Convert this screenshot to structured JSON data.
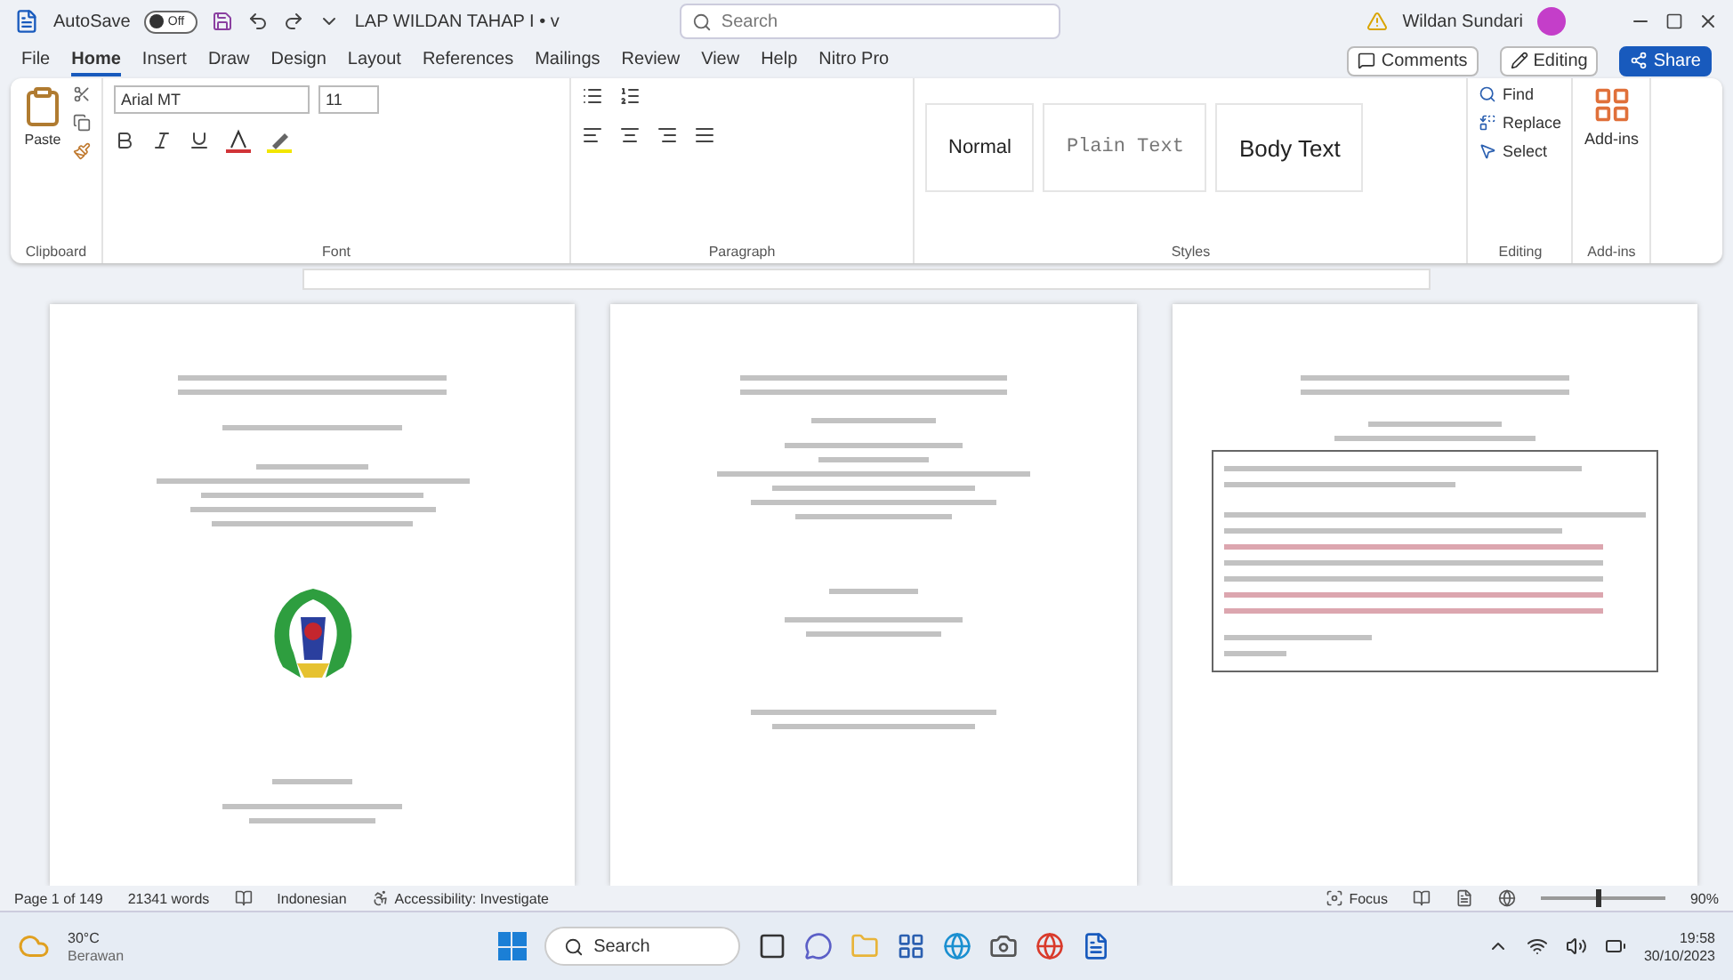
{
  "title_bar": {
    "autosave_label": "AutoSave",
    "autosave_state": "Off",
    "autosave_on": false,
    "document_title": "LAP WILDAN TAHAP I • v",
    "search_placeholder": "Search",
    "user_name": "Wildan Sundari"
  },
  "menu_tabs": [
    {
      "label": "File",
      "selected": false
    },
    {
      "label": "Home",
      "selected": true
    },
    {
      "label": "Insert",
      "selected": false
    },
    {
      "label": "Draw",
      "selected": false
    },
    {
      "label": "Design",
      "selected": false
    },
    {
      "label": "Layout",
      "selected": false
    },
    {
      "label": "References",
      "selected": false
    },
    {
      "label": "Mailings",
      "selected": false
    },
    {
      "label": "Review",
      "selected": false
    },
    {
      "label": "View",
      "selected": false
    },
    {
      "label": "Help",
      "selected": false
    },
    {
      "label": "Nitro Pro",
      "selected": false
    }
  ],
  "header_buttons": {
    "comments": "Comments",
    "editing": "Editing",
    "share": "Share"
  },
  "ribbon": {
    "paste": "Paste",
    "font_name": "Arial MT",
    "font_size": "11",
    "styles": [
      {
        "label": "Normal",
        "kind": "normal"
      },
      {
        "label": "Plain Text",
        "kind": "mono"
      },
      {
        "label": "Body Text",
        "kind": "body"
      }
    ],
    "editing": [
      "Find",
      "Replace",
      "Select"
    ],
    "addins": "Add-ins",
    "groups": [
      "Clipboard",
      "Font",
      "Paragraph",
      "Styles",
      "Editing",
      "Add-ins"
    ]
  },
  "pages": [
    {
      "kind": "cover"
    },
    {
      "kind": "approval"
    },
    {
      "kind": "statement"
    }
  ],
  "status_bar": {
    "page": "Page 1 of 149",
    "words": "21341 words",
    "language": "Indonesian",
    "accessibility": "Accessibility: Investigate",
    "focus": "Focus",
    "zoom_slider": {
      "level": 0.45
    },
    "zoom": "90%"
  },
  "taskbar": {
    "temperature": "30°C",
    "weather": "Berawan",
    "search": "Search",
    "time": "19:58",
    "date": "30/10/2023"
  }
}
